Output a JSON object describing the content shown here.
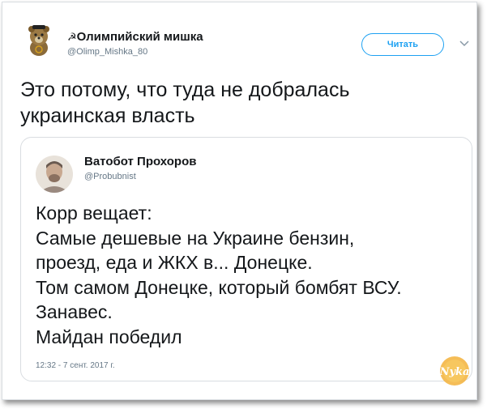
{
  "tweet": {
    "author": {
      "display_name": "Олимпийский мишка",
      "handle": "@Olimp_Mishka_80",
      "avatar_icon": "bear-mascot-icon"
    },
    "follow_button_label": "Читать",
    "menu_icon": "chevron-down-icon",
    "text_lines": [
      "Это потому, что туда не добралась",
      "украинская власть"
    ]
  },
  "quoted_tweet": {
    "author": {
      "display_name": "Ватобот Прохоров",
      "handle": "@Probubnist",
      "avatar_icon": "person-photo-avatar"
    },
    "text_lines": [
      "Корр вещает:",
      "Самые дешевые на Украине бензин,",
      "проезд, еда и ЖКХ в... Донецке.",
      "Том самом Донецке, который бомбят ВСУ.",
      "Занавес.",
      "Майдан победил"
    ],
    "timestamp": "12:32 - 7 сент. 2017 г."
  },
  "watermark": {
    "text": "Nyka",
    "color": "#f0a020"
  },
  "colors": {
    "accent": "#1da1f2",
    "text": "#14171a",
    "muted": "#657786",
    "border": "#d9dde1"
  }
}
